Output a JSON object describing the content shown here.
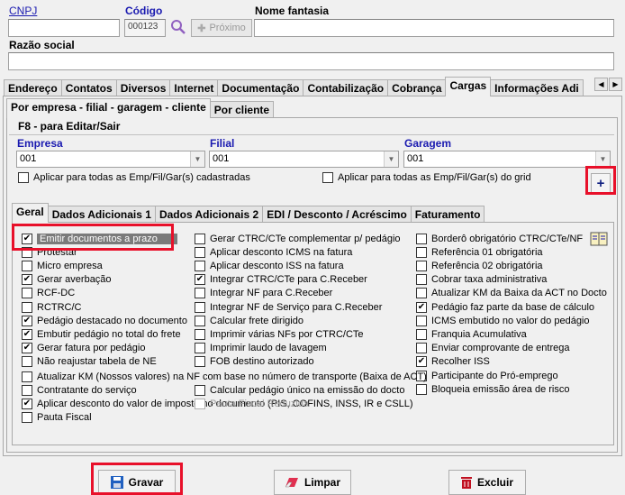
{
  "header": {
    "cnpj_label": "CNPJ",
    "codigo_label": "Código",
    "codigo_value": "000123",
    "proximo_label": "Próximo",
    "nome_fantasia_label": "Nome fantasia",
    "razao_social_label": "Razão social"
  },
  "main_tabs": [
    "Endereço",
    "Contatos",
    "Diversos",
    "Internet",
    "Documentação",
    "Contabilização",
    "Cobrança",
    "Cargas",
    "Informações Adi"
  ],
  "main_tabs_active": "Cargas",
  "sub_tabs": [
    "Por empresa - filial - garagem - cliente",
    "Por cliente"
  ],
  "panel": {
    "title": "F8 - para Editar/Sair",
    "empresa_label": "Empresa",
    "empresa_value": "001",
    "filial_label": "Filial",
    "filial_value": "001",
    "garagem_label": "Garagem",
    "garagem_value": "001",
    "aplicar_cadastradas": "Aplicar para todas as Emp/Fil/Gar(s) cadastradas",
    "aplicar_grid": "Aplicar para todas as Emp/Fil/Gar(s) do grid",
    "add_symbol": "+"
  },
  "inner_tabs": [
    "Geral",
    "Dados Adicionais 1",
    "Dados Adicionais 2",
    "EDI / Desconto / Acréscimo",
    "Faturamento"
  ],
  "col1": [
    {
      "label": "Emitir documentos a prazo",
      "checked": true
    },
    {
      "label": "Protestar",
      "checked": false
    },
    {
      "label": "Micro empresa",
      "checked": false
    },
    {
      "label": "Gerar averbação",
      "checked": true
    },
    {
      "label": "RCF-DC",
      "checked": false
    },
    {
      "label": "RCTRC/C",
      "checked": false
    },
    {
      "label": "Pedágio destacado no documento",
      "checked": true
    },
    {
      "label": "Embutir pedágio no total do frete",
      "checked": true
    },
    {
      "label": "Gerar fatura por pedágio",
      "checked": true
    },
    {
      "label": "Não reajustar tabela de NE",
      "checked": false
    }
  ],
  "col2": [
    {
      "label": "Gerar CTRC/CTe complementar p/ pedágio",
      "checked": false
    },
    {
      "label": "Aplicar desconto ICMS na fatura",
      "checked": false
    },
    {
      "label": "Aplicar desconto ISS na fatura",
      "checked": false
    },
    {
      "label": "Integrar CTRC/CTe para C.Receber",
      "checked": true
    },
    {
      "label": "Integrar NF para C.Receber",
      "checked": false
    },
    {
      "label": "Integrar NF de Serviço para C.Receber",
      "checked": false
    },
    {
      "label": "Calcular frete dirigido",
      "checked": false
    },
    {
      "label": "Imprimir várias NFs por CTRC/CTe",
      "checked": false
    },
    {
      "label": "Imprimir laudo de lavagem",
      "checked": false
    },
    {
      "label": "FOB destino autorizado",
      "checked": false
    }
  ],
  "col3": [
    {
      "label": "Borderô obrigatório  CTRC/CTe/NF",
      "checked": false
    },
    {
      "label": "Referência 01 obrigatória",
      "checked": false
    },
    {
      "label": "Referência 02 obrigatória",
      "checked": false
    },
    {
      "label": "Cobrar taxa administrativa",
      "checked": false
    },
    {
      "label": "Atualizar KM da Baixa da ACT no Docto",
      "checked": false
    },
    {
      "label": "Pedágio faz parte da base de cálculo",
      "checked": true
    },
    {
      "label": "ICMS embutido no valor do pedágio",
      "checked": false
    },
    {
      "label": "Franquia Acumulativa",
      "checked": false
    },
    {
      "label": "Enviar comprovante de entrega",
      "checked": false
    },
    {
      "label": "Recolher ISS",
      "checked": true
    },
    {
      "label": "Participante do Pró-emprego",
      "checked": false
    },
    {
      "label": "Bloqueia emissão área de risco",
      "checked": false
    }
  ],
  "wide_rows": [
    {
      "label": "Atualizar KM (Nossos valores) na NF com base no número de transporte (Baixa de ACT)",
      "checked": false
    },
    {
      "label": "Contratante do serviço",
      "checked": false
    },
    {
      "label": "Aplicar desconto do valor de imposto no documento (PIS, COFINS, INSS, IR e CSLL)",
      "checked": true
    },
    {
      "label": "Pauta Fiscal",
      "checked": false
    }
  ],
  "extra_col2": [
    {
      "label": "Calcular pedágio único na emissão do docto",
      "checked": false
    },
    {
      "label": "Pauta Fiscal Reduzida",
      "checked": false,
      "disabled": true
    }
  ],
  "footer": {
    "gravar": "Gravar",
    "limpar": "Limpar",
    "excluir": "Excluir"
  },
  "colors": {
    "highlight_red": "#e8102a",
    "label_blue": "#1a1ab0"
  }
}
